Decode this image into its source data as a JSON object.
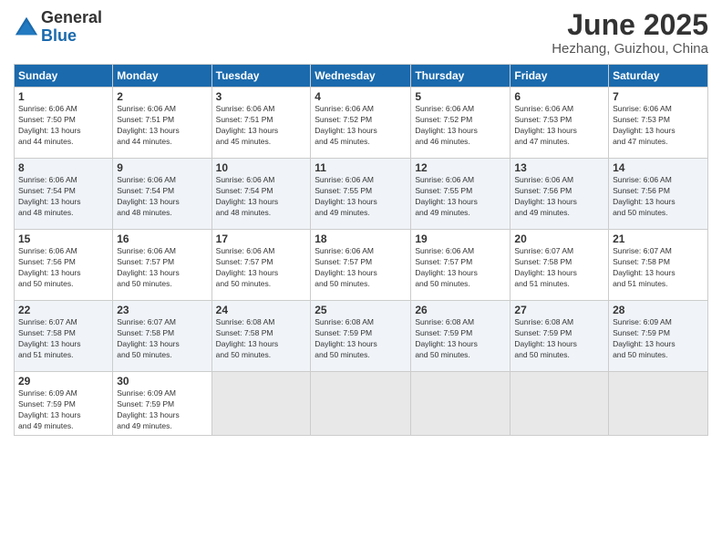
{
  "header": {
    "logo_general": "General",
    "logo_blue": "Blue",
    "month_title": "June 2025",
    "location": "Hezhang, Guizhou, China"
  },
  "weekdays": [
    "Sunday",
    "Monday",
    "Tuesday",
    "Wednesday",
    "Thursday",
    "Friday",
    "Saturday"
  ],
  "weeks": [
    [
      {
        "day": "1",
        "sunrise": "6:06 AM",
        "sunset": "7:50 PM",
        "daylight": "13 hours and 44 minutes."
      },
      {
        "day": "2",
        "sunrise": "6:06 AM",
        "sunset": "7:51 PM",
        "daylight": "13 hours and 44 minutes."
      },
      {
        "day": "3",
        "sunrise": "6:06 AM",
        "sunset": "7:51 PM",
        "daylight": "13 hours and 45 minutes."
      },
      {
        "day": "4",
        "sunrise": "6:06 AM",
        "sunset": "7:52 PM",
        "daylight": "13 hours and 45 minutes."
      },
      {
        "day": "5",
        "sunrise": "6:06 AM",
        "sunset": "7:52 PM",
        "daylight": "13 hours and 46 minutes."
      },
      {
        "day": "6",
        "sunrise": "6:06 AM",
        "sunset": "7:53 PM",
        "daylight": "13 hours and 47 minutes."
      },
      {
        "day": "7",
        "sunrise": "6:06 AM",
        "sunset": "7:53 PM",
        "daylight": "13 hours and 47 minutes."
      }
    ],
    [
      {
        "day": "8",
        "sunrise": "6:06 AM",
        "sunset": "7:54 PM",
        "daylight": "13 hours and 48 minutes."
      },
      {
        "day": "9",
        "sunrise": "6:06 AM",
        "sunset": "7:54 PM",
        "daylight": "13 hours and 48 minutes."
      },
      {
        "day": "10",
        "sunrise": "6:06 AM",
        "sunset": "7:54 PM",
        "daylight": "13 hours and 48 minutes."
      },
      {
        "day": "11",
        "sunrise": "6:06 AM",
        "sunset": "7:55 PM",
        "daylight": "13 hours and 49 minutes."
      },
      {
        "day": "12",
        "sunrise": "6:06 AM",
        "sunset": "7:55 PM",
        "daylight": "13 hours and 49 minutes."
      },
      {
        "day": "13",
        "sunrise": "6:06 AM",
        "sunset": "7:56 PM",
        "daylight": "13 hours and 49 minutes."
      },
      {
        "day": "14",
        "sunrise": "6:06 AM",
        "sunset": "7:56 PM",
        "daylight": "13 hours and 50 minutes."
      }
    ],
    [
      {
        "day": "15",
        "sunrise": "6:06 AM",
        "sunset": "7:56 PM",
        "daylight": "13 hours and 50 minutes."
      },
      {
        "day": "16",
        "sunrise": "6:06 AM",
        "sunset": "7:57 PM",
        "daylight": "13 hours and 50 minutes."
      },
      {
        "day": "17",
        "sunrise": "6:06 AM",
        "sunset": "7:57 PM",
        "daylight": "13 hours and 50 minutes."
      },
      {
        "day": "18",
        "sunrise": "6:06 AM",
        "sunset": "7:57 PM",
        "daylight": "13 hours and 50 minutes."
      },
      {
        "day": "19",
        "sunrise": "6:06 AM",
        "sunset": "7:57 PM",
        "daylight": "13 hours and 50 minutes."
      },
      {
        "day": "20",
        "sunrise": "6:07 AM",
        "sunset": "7:58 PM",
        "daylight": "13 hours and 51 minutes."
      },
      {
        "day": "21",
        "sunrise": "6:07 AM",
        "sunset": "7:58 PM",
        "daylight": "13 hours and 51 minutes."
      }
    ],
    [
      {
        "day": "22",
        "sunrise": "6:07 AM",
        "sunset": "7:58 PM",
        "daylight": "13 hours and 51 minutes."
      },
      {
        "day": "23",
        "sunrise": "6:07 AM",
        "sunset": "7:58 PM",
        "daylight": "13 hours and 50 minutes."
      },
      {
        "day": "24",
        "sunrise": "6:08 AM",
        "sunset": "7:58 PM",
        "daylight": "13 hours and 50 minutes."
      },
      {
        "day": "25",
        "sunrise": "6:08 AM",
        "sunset": "7:59 PM",
        "daylight": "13 hours and 50 minutes."
      },
      {
        "day": "26",
        "sunrise": "6:08 AM",
        "sunset": "7:59 PM",
        "daylight": "13 hours and 50 minutes."
      },
      {
        "day": "27",
        "sunrise": "6:08 AM",
        "sunset": "7:59 PM",
        "daylight": "13 hours and 50 minutes."
      },
      {
        "day": "28",
        "sunrise": "6:09 AM",
        "sunset": "7:59 PM",
        "daylight": "13 hours and 50 minutes."
      }
    ],
    [
      {
        "day": "29",
        "sunrise": "6:09 AM",
        "sunset": "7:59 PM",
        "daylight": "13 hours and 49 minutes."
      },
      {
        "day": "30",
        "sunrise": "6:09 AM",
        "sunset": "7:59 PM",
        "daylight": "13 hours and 49 minutes."
      },
      null,
      null,
      null,
      null,
      null
    ]
  ],
  "labels": {
    "sunrise": "Sunrise:",
    "sunset": "Sunset:",
    "daylight": "Daylight:"
  }
}
